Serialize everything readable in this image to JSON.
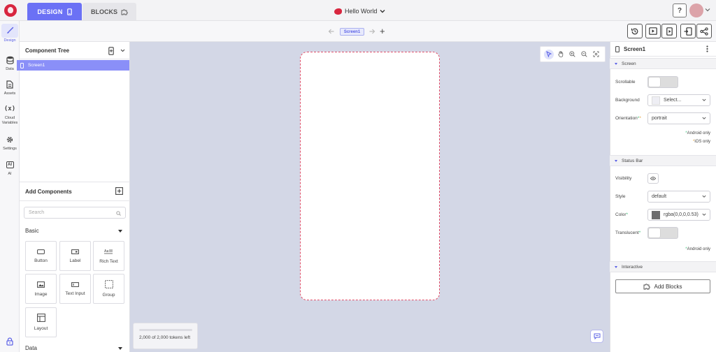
{
  "header": {
    "tabs": [
      {
        "label": "DESIGN",
        "active": true
      },
      {
        "label": "BLOCKS",
        "active": false
      }
    ],
    "project_name": "Hello World",
    "help_label": "?"
  },
  "rail": {
    "items": [
      {
        "label": "Design",
        "icon": "brush-icon",
        "active": true
      },
      {
        "label": "Data",
        "icon": "database-icon"
      },
      {
        "label": "Assets",
        "icon": "file-icon"
      },
      {
        "label": "Cloud\nVariables",
        "icon": "variable-icon",
        "glyph": "(x)"
      },
      {
        "label": "Settings",
        "icon": "gear-icon"
      },
      {
        "label": "AI",
        "icon": "ai-icon",
        "glyph": "AI"
      }
    ]
  },
  "screenbar": {
    "current_screen": "Screen1",
    "add_label": "+"
  },
  "component_tree": {
    "title": "Component Tree",
    "items": [
      {
        "label": "Screen1",
        "selected": true
      }
    ]
  },
  "add_components": {
    "title": "Add Components",
    "search_placeholder": "Search",
    "basic_title": "Basic",
    "components": [
      {
        "label": "Button"
      },
      {
        "label": "Label"
      },
      {
        "label": "Rich Text"
      },
      {
        "label": "Image"
      },
      {
        "label": "Text Input"
      },
      {
        "label": "Group"
      },
      {
        "label": "Layout"
      }
    ],
    "data_title": "Data"
  },
  "canvas": {
    "tokens_text": "2,000 of 2,000 tokens left",
    "tokens_used_fraction": 0
  },
  "properties": {
    "title": "Screen1",
    "screen_section": "Screen",
    "scrollable_label": "Scrollable",
    "background_label": "Background",
    "background_value": "Select...",
    "orientation_label": "Orientation",
    "orientation_value": "portrait",
    "android_only": "Android only",
    "ios_only": "iOS only",
    "status_section": "Status Bar",
    "visibility_label": "Visibility",
    "style_label": "Style",
    "style_value": "default",
    "color_label": "Color",
    "color_value": "rgba(0,0,0,0.53)",
    "translucent_label": "Translucent",
    "android_only_2": "Android only",
    "interactive_section": "Interactive",
    "add_blocks_label": "Add Blocks"
  },
  "colors": {
    "accent": "#6b71f5",
    "brand": "#d8263f",
    "android_marker": "#3dc27a",
    "ios_marker": "#e6a23c",
    "canvas_bg": "#d3d7e6"
  }
}
